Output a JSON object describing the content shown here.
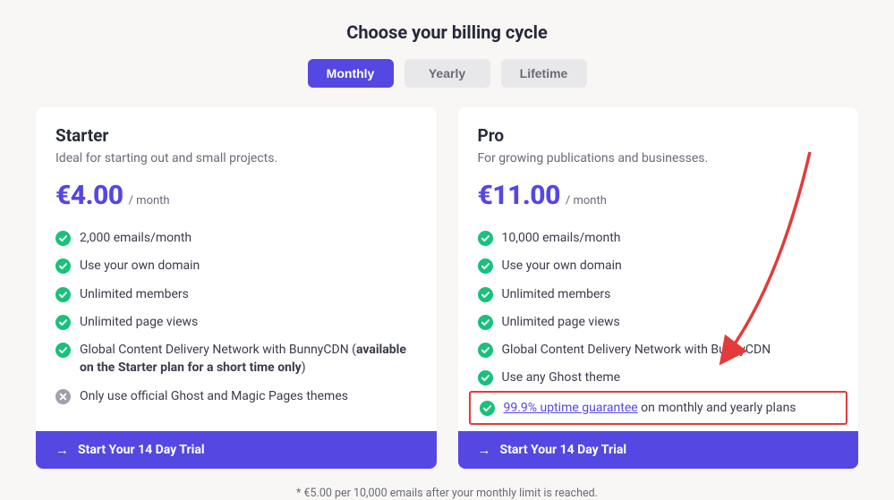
{
  "heading": "Choose your billing cycle",
  "cycles": [
    {
      "label": "Monthly",
      "active": true
    },
    {
      "label": "Yearly",
      "active": false
    },
    {
      "label": "Lifetime",
      "active": false
    }
  ],
  "plans": {
    "starter": {
      "name": "Starter",
      "tagline": "Ideal for starting out and small projects.",
      "price": "€4.00",
      "interval": "/ month",
      "features": [
        {
          "type": "check",
          "text": "2,000 emails/month"
        },
        {
          "type": "check",
          "text": "Use your own domain"
        },
        {
          "type": "check",
          "text": "Unlimited members"
        },
        {
          "type": "check",
          "text": "Unlimited page views"
        },
        {
          "type": "check",
          "html": "Global Content Delivery Network with BunnyCDN (<b>available on the Starter plan for a short time only</b>)"
        },
        {
          "type": "cross",
          "text": "Only use official Ghost and Magic Pages themes"
        }
      ],
      "cta": "Start Your 14 Day Trial"
    },
    "pro": {
      "name": "Pro",
      "tagline": "For growing publications and businesses.",
      "price": "€11.00",
      "interval": "/ month",
      "features": [
        {
          "type": "check",
          "text": "10,000 emails/month"
        },
        {
          "type": "check",
          "text": "Use your own domain"
        },
        {
          "type": "check",
          "text": "Unlimited members"
        },
        {
          "type": "check",
          "text": "Unlimited page views"
        },
        {
          "type": "check",
          "text": "Global Content Delivery Network with BunnyCDN"
        },
        {
          "type": "check",
          "text": "Use any Ghost theme"
        },
        {
          "type": "check",
          "highlighted": true,
          "html": "<a href='#'>99.9% uptime guarantee</a> on monthly and yearly plans"
        }
      ],
      "cta": "Start Your 14 Day Trial"
    }
  },
  "footnote": "* €5.00 per 10,000 emails after your monthly limit is reached."
}
